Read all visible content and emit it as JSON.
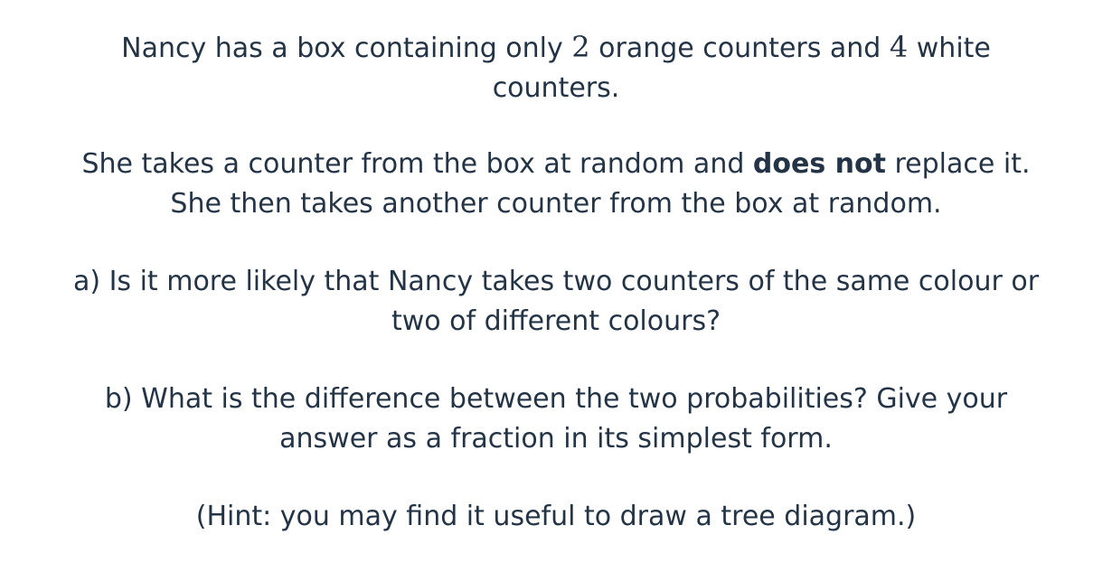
{
  "question": {
    "intro": {
      "text_a": "Nancy has a box containing only ",
      "num_orange": "2",
      "text_b": " orange counters and ",
      "num_white": "4",
      "text_c": " white",
      "text_d": "counters."
    },
    "draw": {
      "line1_a": "She takes a counter from the box at random and ",
      "line1_bold": "does not",
      "line1_b": " replace it.",
      "line2": "She then takes another counter from the box at random."
    },
    "part_a": {
      "line1": "a) Is it more likely that Nancy takes two counters of the same colour or",
      "line2": "two of different colours?"
    },
    "part_b": {
      "line1": "b) What is the difference between the two probabilities? Give your",
      "line2": "answer as a fraction in its simplest form."
    },
    "hint": "(Hint: you may find it useful to draw a tree diagram.)"
  }
}
